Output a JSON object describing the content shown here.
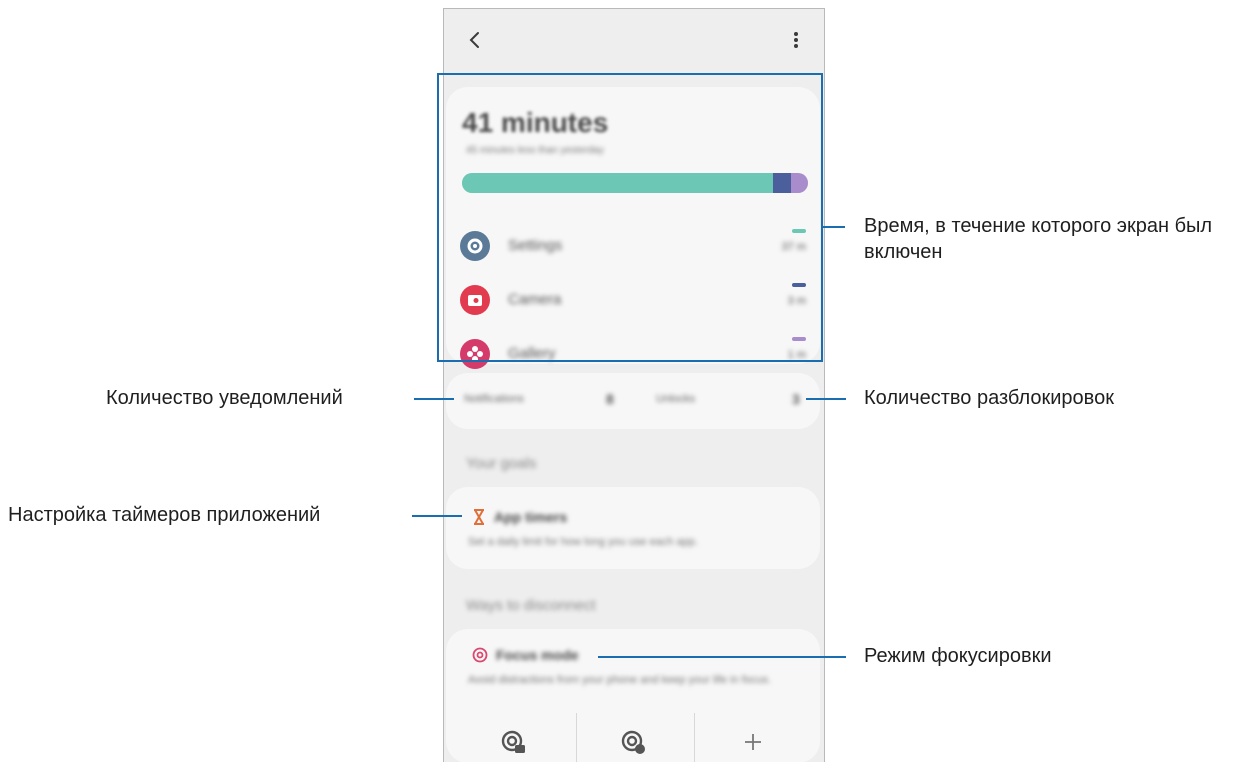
{
  "screen": {
    "back_icon": "chevron-left-icon",
    "more_icon": "more-vertical-icon",
    "usage": {
      "total": "41 minutes",
      "subtitle": "45 minutes less than yesterday",
      "bar_segments": [
        {
          "color": "#6cc8b4",
          "fraction": 0.9
        },
        {
          "color": "#4a5f9b",
          "fraction": 0.05
        },
        {
          "color": "#a98ccc",
          "fraction": 0.05
        }
      ]
    },
    "apps": [
      {
        "name": "Settings",
        "time": "37 m",
        "icon": "gear-icon",
        "icon_color": "#5b7a97",
        "dash_color": "#6cc8b4"
      },
      {
        "name": "Camera",
        "time": "3 m",
        "icon": "camera-icon",
        "icon_color": "#e23a4f",
        "dash_color": "#4a5f9b"
      },
      {
        "name": "Gallery",
        "time": "1 m",
        "icon": "flower-icon",
        "icon_color": "#d43a6a",
        "dash_color": "#a98ccc"
      }
    ],
    "stats": {
      "notifications_label": "Notifications",
      "notifications_value": "8",
      "unlocks_label": "Unlocks",
      "unlocks_value": "3"
    },
    "goals_title": "Your goals",
    "app_timers": {
      "title": "App timers",
      "desc": "Set a daily limit for how long you use each app.",
      "icon": "hourglass-icon"
    },
    "ways_title": "Ways to disconnect",
    "focus_mode": {
      "title": "Focus mode",
      "desc": "Avoid distractions from your phone and keep your life in focus.",
      "icon": "target-icon",
      "modes": [
        "work-mode-icon",
        "me-time-icon",
        "add-icon"
      ]
    }
  },
  "callouts": {
    "screen_on_time": "Время, в течение которого экран был включен",
    "notifications": "Количество уведомлений",
    "unlocks": "Количество разблокировок",
    "app_timers": "Настройка таймеров приложений",
    "focus_mode": "Режим фокусировки"
  },
  "colors": {
    "accent": "#1a6eb0"
  }
}
